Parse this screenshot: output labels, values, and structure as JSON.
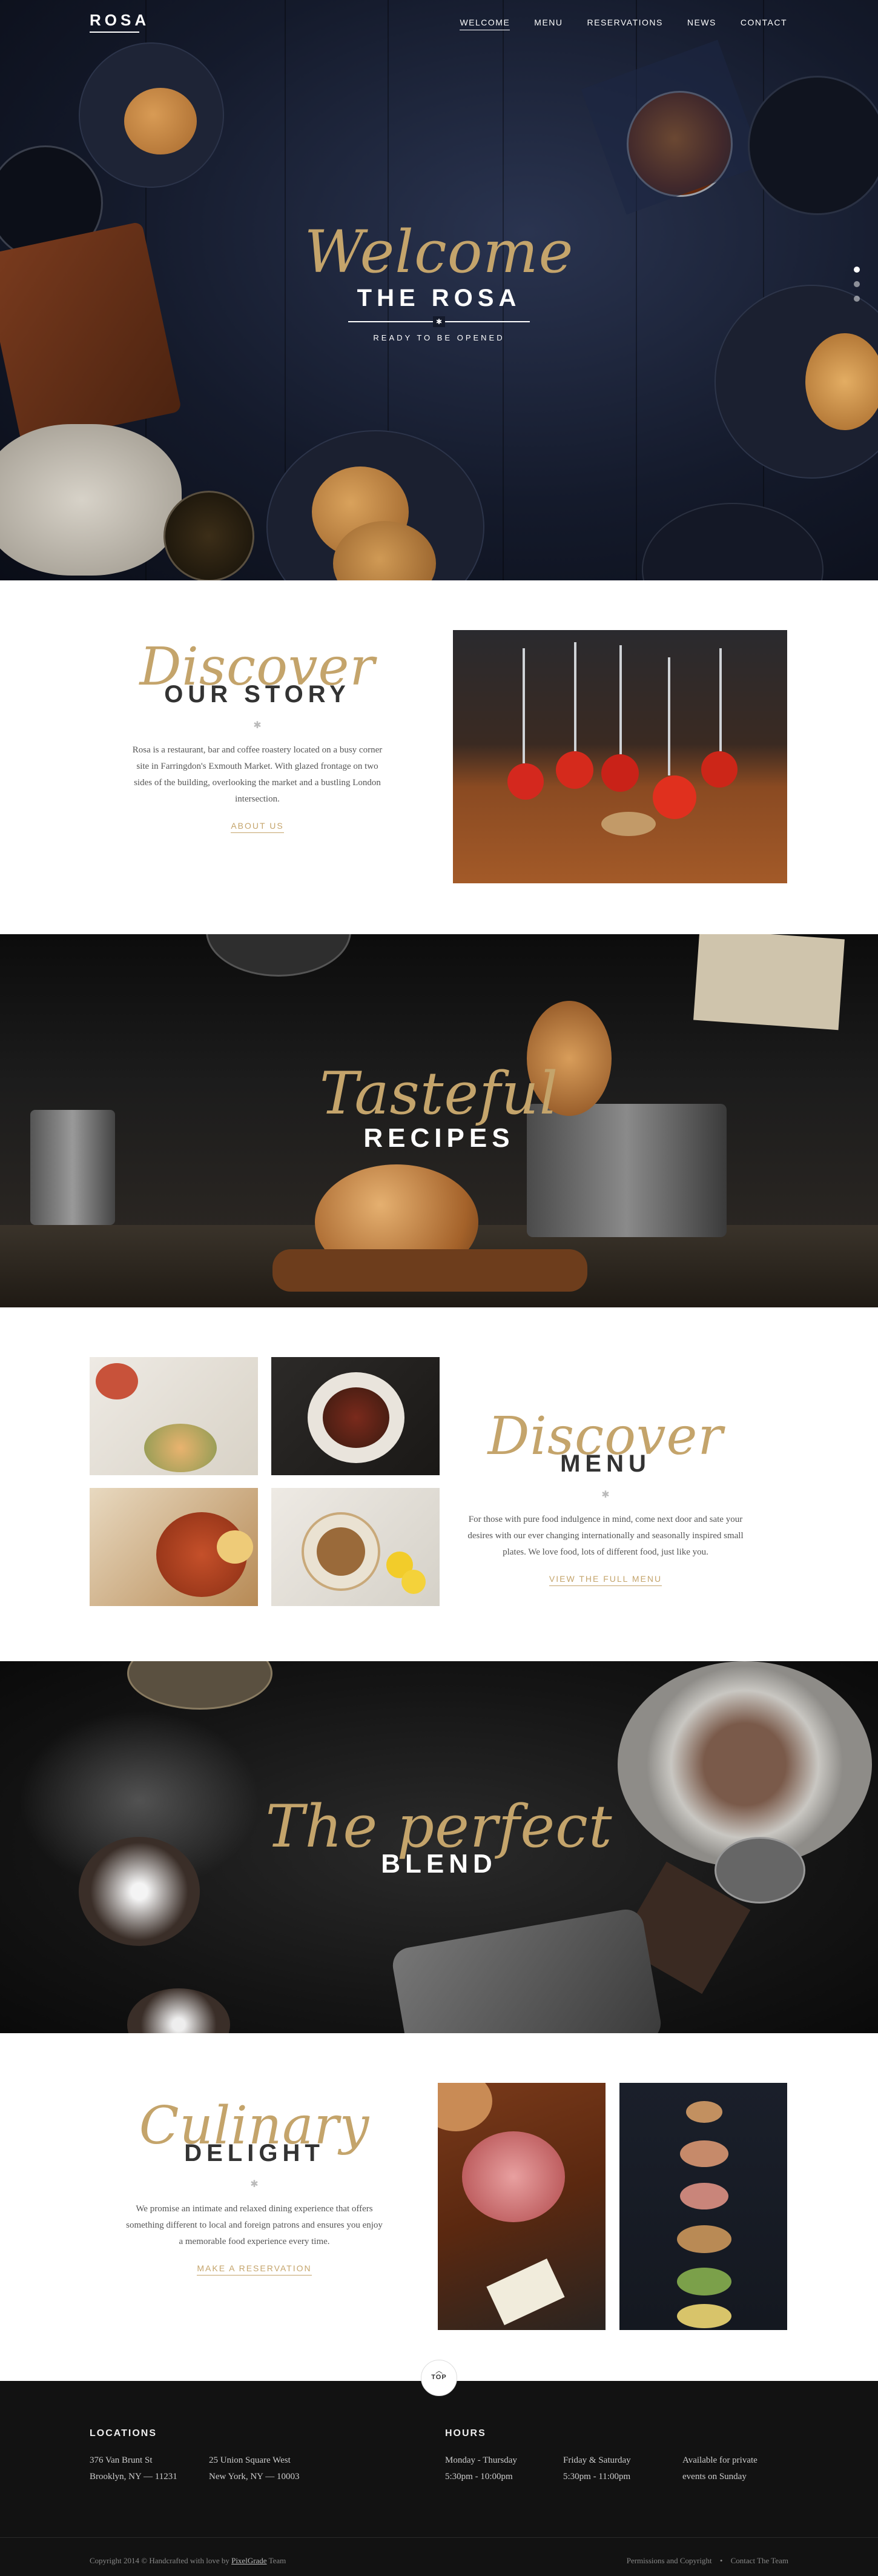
{
  "nav": {
    "logo": "ROSA",
    "items": [
      "WELCOME",
      "MENU",
      "RESERVATIONS",
      "NEWS",
      "CONTACT"
    ],
    "active_index": 0
  },
  "hero": {
    "script": "Welcome",
    "title": "THE ROSA",
    "subtitle": "READY TO BE OPENED",
    "slides": 3,
    "active_slide": 1
  },
  "story": {
    "script": "Discover",
    "title": "OUR STORY",
    "text": "Rosa is a restaurant, bar and coffee roastery located on a busy corner site in Farringdon's Exmouth Market. With glazed frontage on two sides of the building, overlooking the market and a bustling London intersection.",
    "link": "ABOUT US"
  },
  "recipes": {
    "script": "Tasteful",
    "title": "RECIPES"
  },
  "menu_block": {
    "script": "Discover",
    "title": "MENU",
    "text": "For those with pure food indulgence in mind, come next door and sate your desires with our ever changing internationally and seasonally inspired small plates. We love food, lots of different food, just like you.",
    "link": "VIEW THE FULL MENU"
  },
  "blend": {
    "script": "The perfect",
    "title": "BLEND"
  },
  "culinary": {
    "script": "Culinary",
    "title": "DELIGHT",
    "text": "We promise an intimate and relaxed dining experience that offers something different to local and foreign patrons and ensures you enjoy a memorable food experience every time.",
    "link": "MAKE A RESERVATION"
  },
  "top_button": "TOP",
  "footer": {
    "locations_title": "LOCATIONS",
    "location1": [
      "376 Van Brunt St",
      "Brooklyn, NY — 11231"
    ],
    "location2": [
      "25 Union Square West",
      "New York, NY — 10003"
    ],
    "hours_title": "HOURS",
    "hours1": [
      "Monday - Thursday",
      "5:30pm - 10:00pm"
    ],
    "hours2": [
      "Friday & Saturday",
      "5:30pm - 11:00pm"
    ],
    "hours3": [
      "Available for private",
      "events on Sunday"
    ],
    "copyright_prefix": "Copyright 2014 © Handcrafted with love by",
    "copyright_link": "PixelGrade",
    "copyright_suffix": "Team",
    "link_permissions": "Permissions and Copyright",
    "link_contact": "Contact The Team"
  },
  "colors": {
    "accent_gold": "#c4a46b",
    "footer_bg": "#121212",
    "hero_bg": "#141a2b"
  }
}
